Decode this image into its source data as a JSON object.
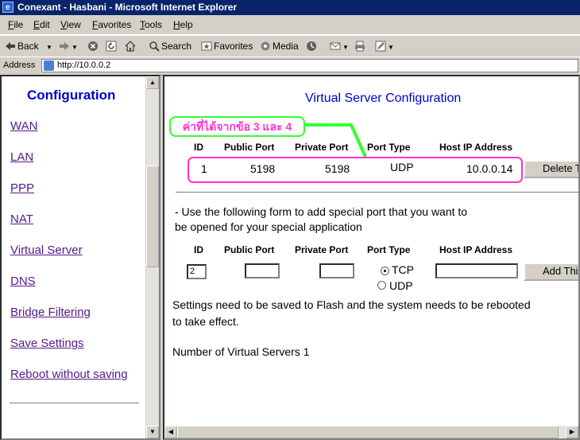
{
  "window": {
    "title": "Conexant - Hasbani - Microsoft Internet Explorer"
  },
  "menu": {
    "items": [
      "File",
      "Edit",
      "View",
      "Favorites",
      "Tools",
      "Help"
    ]
  },
  "toolbar": {
    "back": "Back",
    "search": "Search",
    "favorites": "Favorites",
    "media": "Media"
  },
  "address": {
    "label": "Address",
    "url": "http://10.0.0.2"
  },
  "nav": {
    "title": "Configuration",
    "links": [
      "WAN",
      "LAN",
      "PPP",
      "NAT",
      "Virtual Server",
      "DNS",
      "Bridge Filtering",
      "Save Settings",
      "Reboot without saving"
    ]
  },
  "main": {
    "title": "Virtual Server Configuration",
    "columns": [
      "ID",
      "Public Port",
      "Private Port",
      "Port Type",
      "Host IP Address"
    ],
    "rows": [
      {
        "id": "1",
        "public_port": "5198",
        "private_port": "5198",
        "port_type": "UDP",
        "host_ip": "10.0.0.14",
        "action": "Delete This"
      }
    ],
    "annotation": "ค่าที่ได้จากข้อ 3 และ 4",
    "form_intro": [
      "- Use the following form to add special port that you want to",
      "be opened for your special application"
    ],
    "form": {
      "id_value": "2",
      "public_port": "",
      "private_port": "",
      "host_ip": "",
      "port_types": [
        "TCP",
        "UDP"
      ],
      "selected_type": "TCP",
      "add_label": "Add This"
    },
    "note": [
      "Settings need to be saved to Flash and the system needs to be rebooted",
      "to take effect."
    ],
    "count_text": "Number of Virtual Servers 1"
  }
}
